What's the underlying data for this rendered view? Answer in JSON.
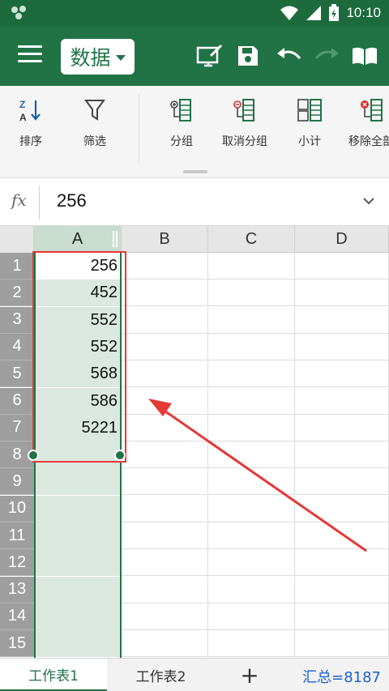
{
  "status_bar": {
    "time": "10:10"
  },
  "app_bar": {
    "menu_icon": "hamburger-icon",
    "current_tab": "数据",
    "actions": [
      "edit-screen-icon",
      "save-icon",
      "undo-icon",
      "redo-icon",
      "book-icon"
    ]
  },
  "ribbon": {
    "buttons": [
      {
        "label": "排序",
        "icon": "sort-az-icon"
      },
      {
        "label": "筛选",
        "icon": "filter-icon"
      },
      {
        "label": "分组",
        "icon": "group-icon"
      },
      {
        "label": "取消分组",
        "icon": "ungroup-icon"
      },
      {
        "label": "小计",
        "icon": "subtotal-icon"
      },
      {
        "label": "移除全部",
        "icon": "remove-all-icon"
      }
    ]
  },
  "formula_bar": {
    "fx_label": "fx",
    "value": "256"
  },
  "grid": {
    "columns": [
      "A",
      "B",
      "C",
      "D"
    ],
    "rows": [
      "1",
      "2",
      "3",
      "4",
      "5",
      "6",
      "7",
      "8",
      "9",
      "10",
      "11",
      "12",
      "13",
      "14",
      "15"
    ],
    "column_a_values": [
      "256",
      "452",
      "552",
      "552",
      "568",
      "586",
      "5221"
    ]
  },
  "sheet_tabs": {
    "tabs": [
      "工作表1",
      "工作表2"
    ],
    "add_label": "+",
    "sum_label": "汇总=8187"
  },
  "colors": {
    "brand": "#217346",
    "annotation": "#e53935",
    "sum_text": "#1a5fd0"
  }
}
